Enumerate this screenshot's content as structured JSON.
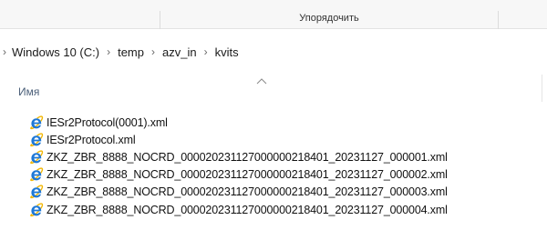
{
  "ribbon": {
    "group_label": "Упорядочить"
  },
  "address": {
    "crumbs": [
      "Windows 10 (C:)",
      "temp",
      "azv_in",
      "kvits"
    ]
  },
  "columns": {
    "name": "Имя"
  },
  "icons": {
    "separator": "chevron-right-icon",
    "sort": "sort-asc-icon",
    "file": "internet-explorer-xml-icon"
  },
  "colors": {
    "ie_blue": "#1e78d6",
    "ie_ring": "#f2b705",
    "header_text": "#4c607a"
  },
  "files": [
    {
      "name": "IESr2Protocol(0001).xml"
    },
    {
      "name": "IESr2Protocol.xml"
    },
    {
      "name": "ZKZ_ZBR_8888_NOCRD_000020231127000000218401_20231127_000001.xml"
    },
    {
      "name": "ZKZ_ZBR_8888_NOCRD_000020231127000000218401_20231127_000002.xml"
    },
    {
      "name": "ZKZ_ZBR_8888_NOCRD_000020231127000000218401_20231127_000003.xml"
    },
    {
      "name": "ZKZ_ZBR_8888_NOCRD_000020231127000000218401_20231127_000004.xml"
    }
  ]
}
